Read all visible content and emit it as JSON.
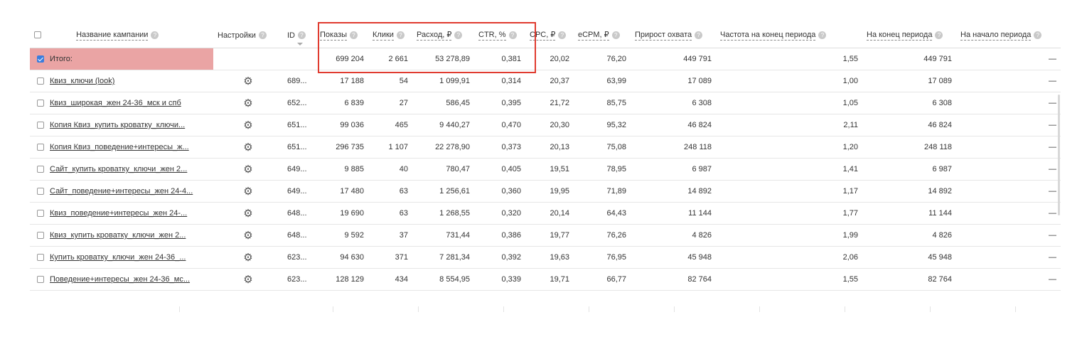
{
  "columns": {
    "name": "Название кампании",
    "settings": "Настройки",
    "id": "ID",
    "impressions": "Показы",
    "clicks": "Клики",
    "spend": "Расход, ₽",
    "ctr": "CTR, %",
    "cpc": "CPC, ₽",
    "ecpm": "eCPM, ₽",
    "reach_growth": "Прирост охвата",
    "freq_end": "Частота на конец периода",
    "reach_end": "На конец периода",
    "reach_start": "На начало периода"
  },
  "help_glyph": "?",
  "settings_glyph": "⚙",
  "total": {
    "label": "Итого:",
    "impressions": "699 204",
    "clicks": "2 661",
    "spend": "53 278,89",
    "ctr": "0,381",
    "cpc": "20,02",
    "ecpm": "76,20",
    "reach_growth": "449 791",
    "freq_end": "1,55",
    "reach_end": "449 791",
    "reach_start": "—"
  },
  "rows": [
    {
      "name": "Квиз_ключи (look)",
      "id": "689...",
      "impressions": "17 188",
      "clicks": "54",
      "spend": "1 099,91",
      "ctr": "0,314",
      "cpc": "20,37",
      "ecpm": "63,99",
      "reach_growth": "17 089",
      "freq_end": "1,00",
      "reach_end": "17 089",
      "reach_start": "—"
    },
    {
      "name": "Квиз_широкая_жен 24-36_мск и спб",
      "id": "652...",
      "impressions": "6 839",
      "clicks": "27",
      "spend": "586,45",
      "ctr": "0,395",
      "cpc": "21,72",
      "ecpm": "85,75",
      "reach_growth": "6 308",
      "freq_end": "1,05",
      "reach_end": "6 308",
      "reach_start": "—"
    },
    {
      "name": "Копия Квиз_купить кроватку_ключи...",
      "id": "651...",
      "impressions": "99 036",
      "clicks": "465",
      "spend": "9 440,27",
      "ctr": "0,470",
      "cpc": "20,30",
      "ecpm": "95,32",
      "reach_growth": "46 824",
      "freq_end": "2,11",
      "reach_end": "46 824",
      "reach_start": "—"
    },
    {
      "name": "Копия Квиз_поведение+интересы_ж...",
      "id": "651...",
      "impressions": "296 735",
      "clicks": "1 107",
      "spend": "22 278,90",
      "ctr": "0,373",
      "cpc": "20,13",
      "ecpm": "75,08",
      "reach_growth": "248 118",
      "freq_end": "1,20",
      "reach_end": "248 118",
      "reach_start": "—"
    },
    {
      "name": "Сайт_купить кроватку_ключи_жен 2...",
      "id": "649...",
      "impressions": "9 885",
      "clicks": "40",
      "spend": "780,47",
      "ctr": "0,405",
      "cpc": "19,51",
      "ecpm": "78,95",
      "reach_growth": "6 987",
      "freq_end": "1,41",
      "reach_end": "6 987",
      "reach_start": "—"
    },
    {
      "name": "Сайт_поведение+интересы_жен 24-4...",
      "id": "649...",
      "impressions": "17 480",
      "clicks": "63",
      "spend": "1 256,61",
      "ctr": "0,360",
      "cpc": "19,95",
      "ecpm": "71,89",
      "reach_growth": "14 892",
      "freq_end": "1,17",
      "reach_end": "14 892",
      "reach_start": "—"
    },
    {
      "name": "Квиз_поведение+интересы_жен 24-...",
      "id": "648...",
      "impressions": "19 690",
      "clicks": "63",
      "spend": "1 268,55",
      "ctr": "0,320",
      "cpc": "20,14",
      "ecpm": "64,43",
      "reach_growth": "11 144",
      "freq_end": "1,77",
      "reach_end": "11 144",
      "reach_start": "—"
    },
    {
      "name": "Квиз_купить кроватку_ключи_жен 2...",
      "id": "648...",
      "impressions": "9 592",
      "clicks": "37",
      "spend": "731,44",
      "ctr": "0,386",
      "cpc": "19,77",
      "ecpm": "76,26",
      "reach_growth": "4 826",
      "freq_end": "1,99",
      "reach_end": "4 826",
      "reach_start": "—"
    },
    {
      "name": "Купить кроватку_ключи_жен 24-36_...",
      "id": "623...",
      "impressions": "94 630",
      "clicks": "371",
      "spend": "7 281,34",
      "ctr": "0,392",
      "cpc": "19,63",
      "ecpm": "76,95",
      "reach_growth": "45 948",
      "freq_end": "2,06",
      "reach_end": "45 948",
      "reach_start": "—"
    },
    {
      "name": "Поведение+интересы_жен 24-36_мс...",
      "id": "623...",
      "impressions": "128 129",
      "clicks": "434",
      "spend": "8 554,95",
      "ctr": "0,339",
      "cpc": "19,71",
      "ecpm": "66,77",
      "reach_growth": "82 764",
      "freq_end": "1,55",
      "reach_end": "82 764",
      "reach_start": "—"
    }
  ],
  "colors": {
    "total_highlight": "#eaa4a4",
    "annotation_box": "#e03b2f",
    "checkbox_checked": "#3b7ddd"
  }
}
